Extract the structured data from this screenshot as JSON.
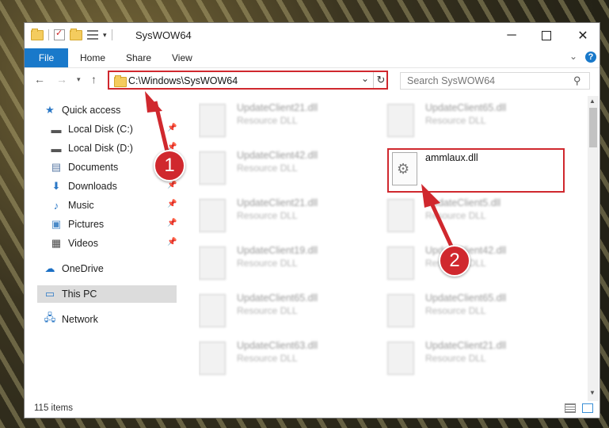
{
  "window": {
    "title": "SysWOW64"
  },
  "ribbon": {
    "tabs": [
      "File",
      "Home",
      "Share",
      "View"
    ]
  },
  "address": {
    "path": "C:\\Windows\\SysWOW64"
  },
  "search": {
    "placeholder": "Search SysWOW64"
  },
  "sidebar": {
    "items": [
      {
        "label": "Quick access",
        "icon": "star-icon"
      },
      {
        "label": "Local Disk (C:)",
        "icon": "drive-icon",
        "pinned": true
      },
      {
        "label": "Local Disk (D:)",
        "icon": "drive-icon",
        "pinned": true
      },
      {
        "label": "Documents",
        "icon": "documents-icon",
        "pinned": true
      },
      {
        "label": "Downloads",
        "icon": "download-icon",
        "pinned": true
      },
      {
        "label": "Music",
        "icon": "music-icon",
        "pinned": true
      },
      {
        "label": "Pictures",
        "icon": "pictures-icon",
        "pinned": true
      },
      {
        "label": "Videos",
        "icon": "videos-icon",
        "pinned": true
      },
      {
        "label": "OneDrive",
        "icon": "cloud-icon"
      },
      {
        "label": "This PC",
        "icon": "computer-icon",
        "selected": true
      },
      {
        "label": "Network",
        "icon": "network-icon"
      }
    ]
  },
  "files": {
    "left": [
      {
        "name": "UpdateClient21.dll",
        "type": "Resource DLL"
      },
      {
        "name": "UpdateClient42.dll",
        "type": "Resource DLL"
      },
      {
        "name": "UpdateClient21.dll",
        "type": "Resource DLL"
      },
      {
        "name": "UpdateClient19.dll",
        "type": "Resource DLL"
      },
      {
        "name": "UpdateClient65.dll",
        "type": "Resource DLL"
      },
      {
        "name": "UpdateClient63.dll",
        "type": "Resource DLL"
      }
    ],
    "right": [
      {
        "name": "UpdateClient65.dll",
        "type": "Resource DLL"
      },
      {
        "name": "UpdateClient5.dll",
        "type": "Resource DLL"
      },
      {
        "name": "UpdateClient42.dll",
        "type": "Resource DLL"
      },
      {
        "name": "UpdateClient65.dll",
        "type": "Resource DLL"
      },
      {
        "name": "UpdateClient21.dll",
        "type": "Resource DLL"
      }
    ],
    "highlighted": {
      "name": "ammlaux.dll"
    }
  },
  "status": {
    "items_count": "115 items"
  },
  "annotations": {
    "badge1": "1",
    "badge2": "2",
    "color": "#d0282e"
  }
}
